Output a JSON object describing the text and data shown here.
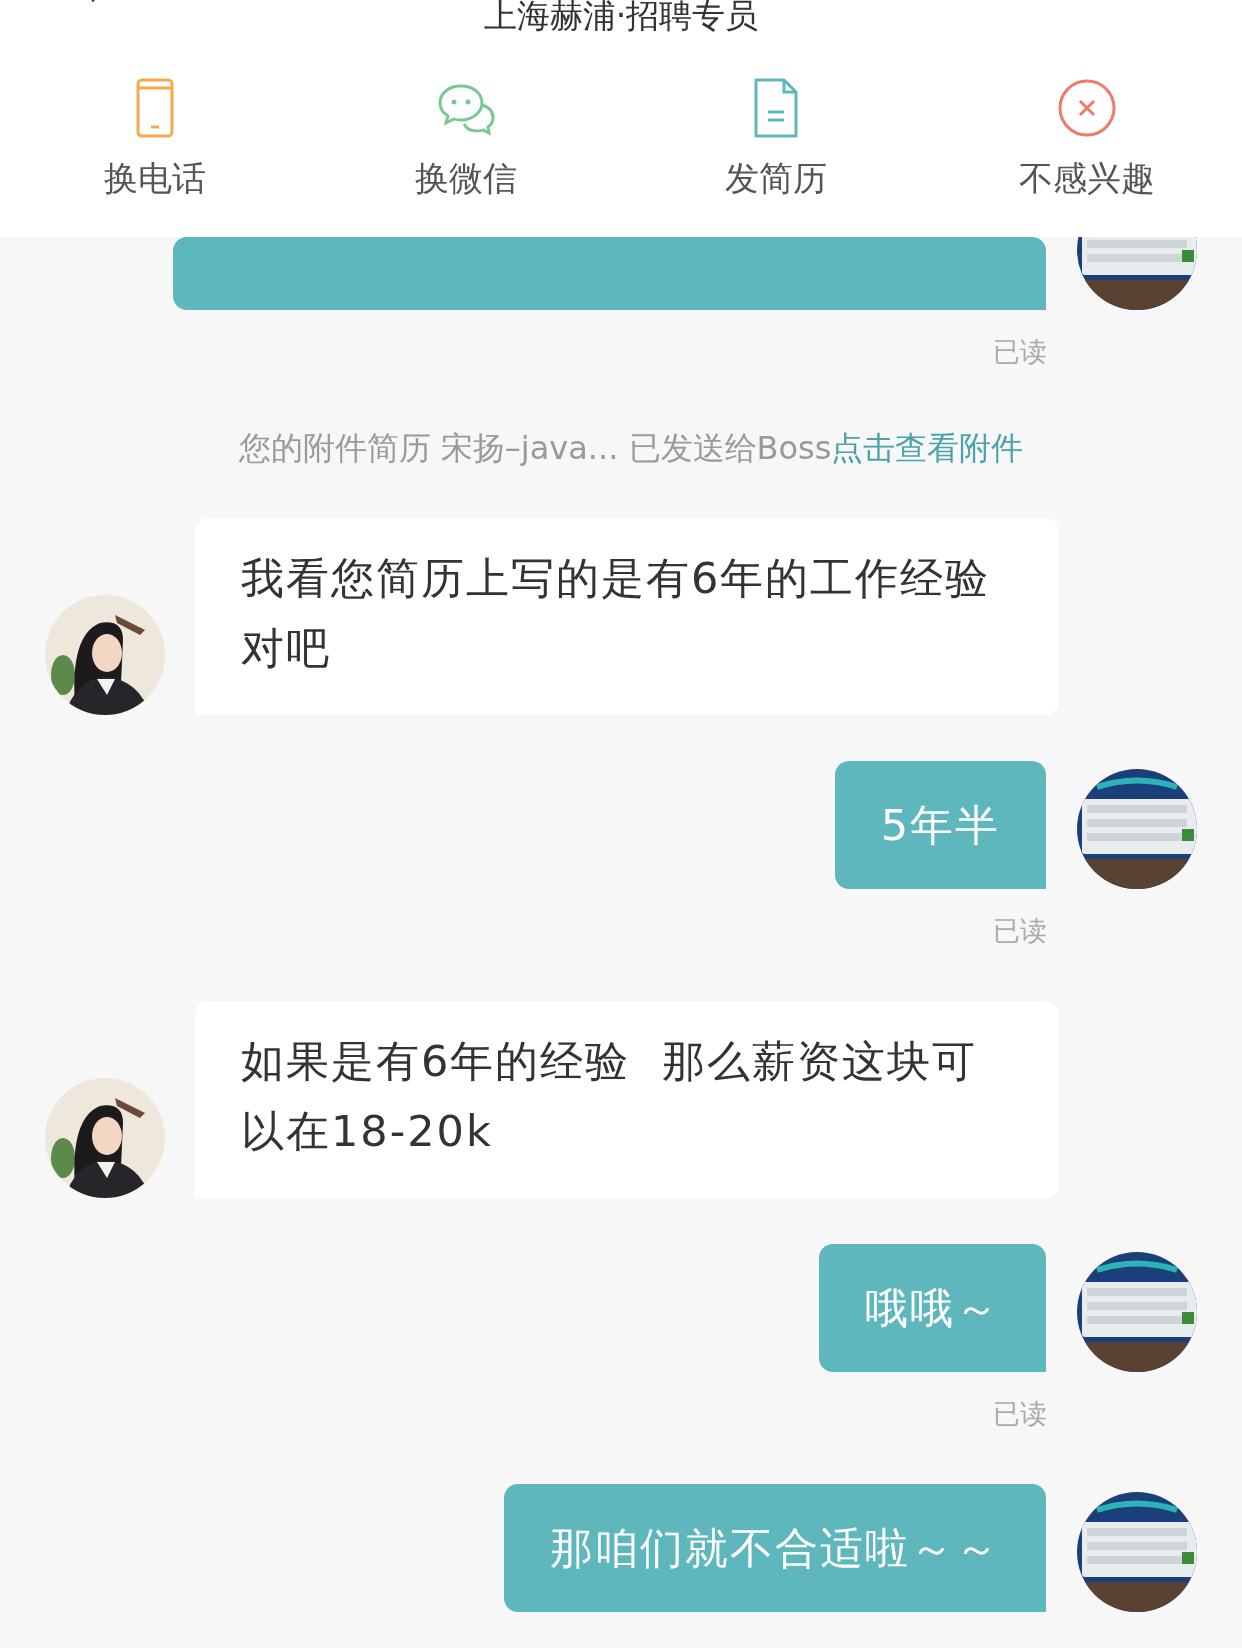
{
  "header": {
    "title": "上海赫浦·招聘专员"
  },
  "actions": [
    {
      "kind": "phone",
      "label": "换电话"
    },
    {
      "kind": "wechat",
      "label": "换微信"
    },
    {
      "kind": "resume",
      "label": "发简历"
    },
    {
      "kind": "reject",
      "label": "不感兴趣"
    }
  ],
  "messages": [
    {
      "kind": "sent"
    },
    {
      "kind": "read",
      "text": "已读"
    },
    {
      "kind": "notice",
      "text": "您的附件简历 宋扬–java... 已发送给Boss",
      "link": "点击查看附件"
    },
    {
      "kind": "received",
      "text": "我看您简历上写的是有6年的工作经验对吧"
    },
    {
      "kind": "sent",
      "text": "5年半"
    },
    {
      "kind": "read",
      "text": "已读"
    },
    {
      "kind": "received",
      "text": "如果是有6年的经验  那么薪资这块可以在18-20k"
    },
    {
      "kind": "sent",
      "text": "哦哦～"
    },
    {
      "kind": "read",
      "text": "已读"
    },
    {
      "kind": "sent",
      "text": "那咱们就不合适啦～～"
    }
  ]
}
